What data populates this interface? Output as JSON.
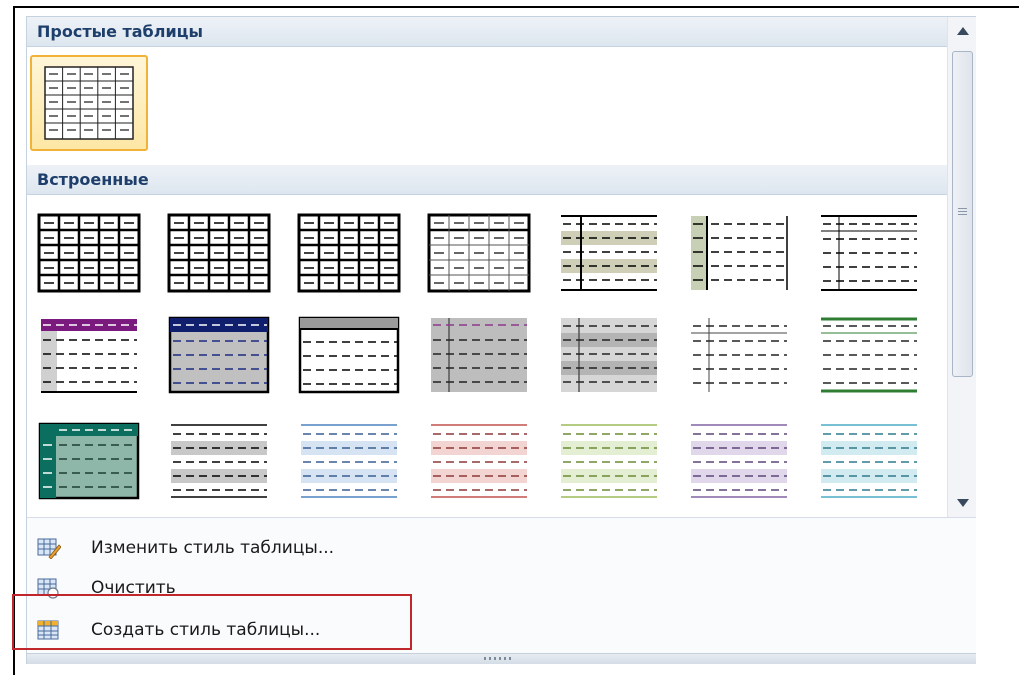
{
  "sections": {
    "plain": "Простые таблицы",
    "builtin": "Встроенные"
  },
  "menu": {
    "modify": "Изменить стиль таблицы...",
    "clear": "Очистить",
    "create": "Создать стиль таблицы..."
  },
  "colors": {
    "accent_selected": "#f2b23a",
    "header_text": "#1e3f6b",
    "highlight": "#c0272d"
  },
  "icons": [
    "table-style-icon",
    "scroll-up-arrow-icon",
    "scroll-down-arrow-icon",
    "edit-table-style-icon",
    "clear-table-style-icon",
    "new-table-style-icon"
  ]
}
